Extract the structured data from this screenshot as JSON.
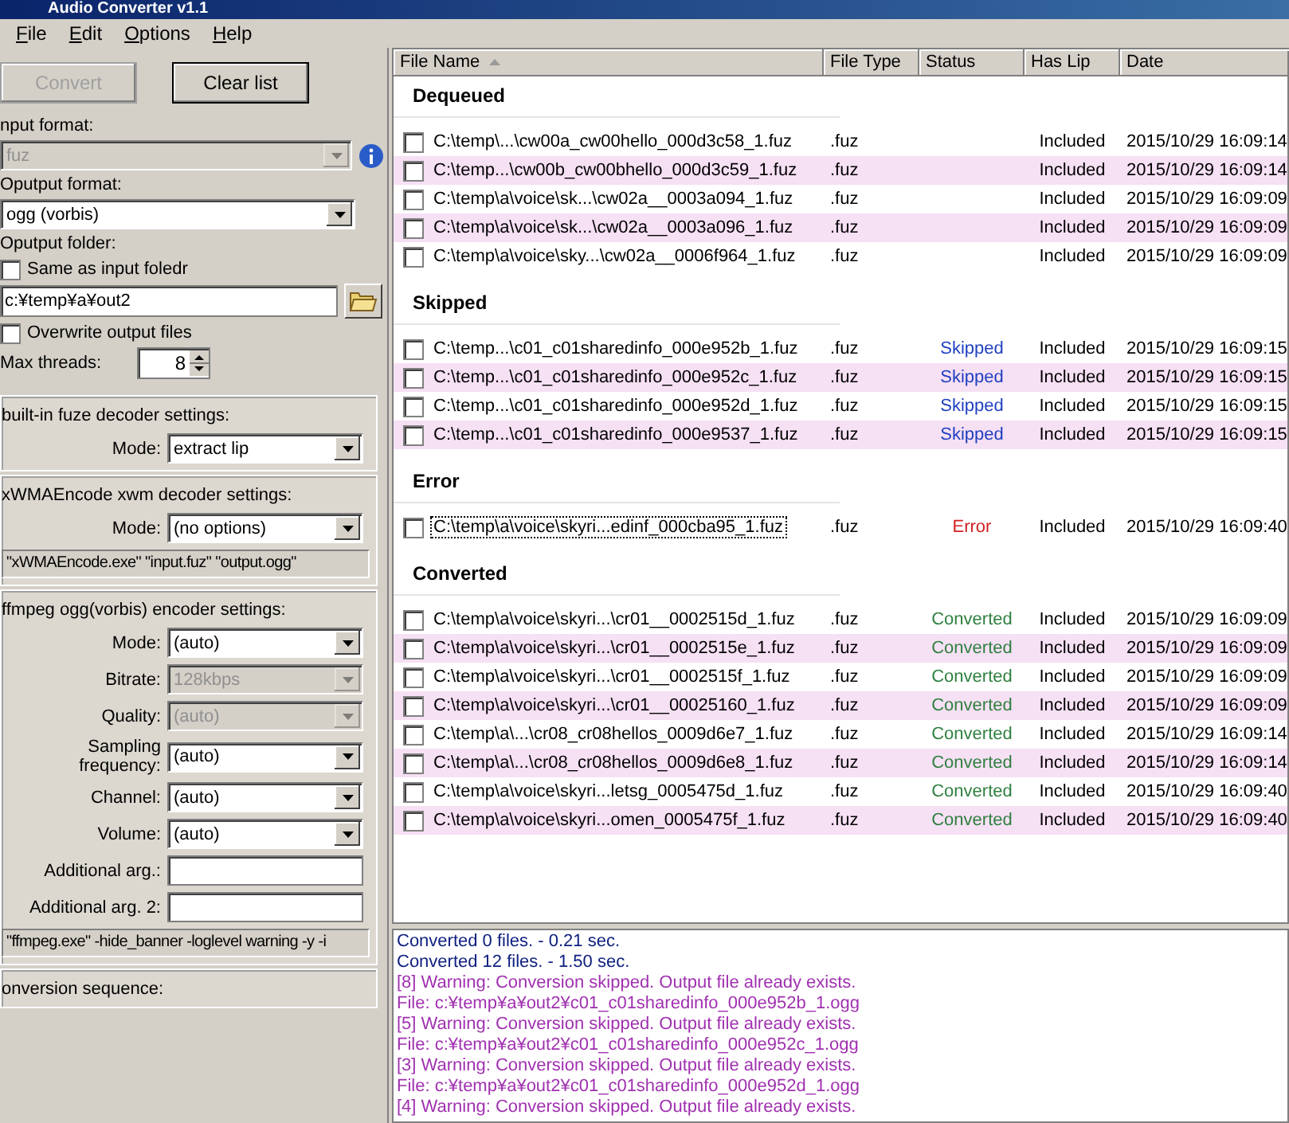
{
  "window": {
    "title": "Audio Converter v1.1"
  },
  "menu": [
    {
      "label": "File"
    },
    {
      "label": "Edit"
    },
    {
      "label": "Options"
    },
    {
      "label": "Help"
    }
  ],
  "buttons": [
    {
      "label": "Convert",
      "disabled": true
    },
    {
      "label": "Clear list",
      "disabled": false
    }
  ],
  "input_format": {
    "label": "nput format:",
    "value": "fuz",
    "disabled": true
  },
  "output_format": {
    "label": "Oputput format:",
    "value": "ogg (vorbis)",
    "disabled": false
  },
  "output_folder": {
    "label": "Oputput folder:",
    "same_as_input": {
      "label": "Same as input foledr",
      "checked": false
    },
    "path": "c:¥temp¥a¥out2"
  },
  "overwrite": {
    "label": "Overwrite output files",
    "checked": false
  },
  "max_threads": {
    "label": "Max threads:",
    "value": "8"
  },
  "groups": [
    {
      "title": "built-in fuze decoder settings:",
      "fields": [
        {
          "kind": "select",
          "label": "Mode:",
          "value": "extract lip",
          "disabled": false
        }
      ]
    },
    {
      "title": "xWMAEncode xwm decoder settings:",
      "fields": [
        {
          "kind": "select",
          "label": "Mode:",
          "value": "(no options)",
          "disabled": false
        }
      ],
      "command": "\"xWMAEncode.exe\" \"input.fuz\" \"output.ogg\""
    },
    {
      "title": "ffmpeg ogg(vorbis) encoder settings:",
      "fields": [
        {
          "kind": "select",
          "label": "Mode:",
          "value": "(auto)",
          "disabled": false
        },
        {
          "kind": "select",
          "label": "Bitrate:",
          "value": "128kbps",
          "disabled": true
        },
        {
          "kind": "select",
          "label": "Quality:",
          "value": "(auto)",
          "disabled": true
        },
        {
          "kind": "select",
          "label": "Sampling frequency:",
          "value": "(auto)",
          "disabled": false
        },
        {
          "kind": "select",
          "label": "Channel:",
          "value": "(auto)",
          "disabled": false
        },
        {
          "kind": "select",
          "label": "Volume:",
          "value": "(auto)",
          "disabled": false
        },
        {
          "kind": "text",
          "label": "Additional arg.:"
        },
        {
          "kind": "text",
          "label": "Additional arg. 2:"
        }
      ],
      "command": "\"ffmpeg.exe\" -hide_banner -loglevel warning -y -i"
    },
    {
      "title": "onversion sequence:"
    }
  ],
  "table": {
    "columns": [
      {
        "label": "File Name",
        "sorted": true
      },
      {
        "label": "File Type",
        "sorted": false
      },
      {
        "label": "Status",
        "sorted": false
      },
      {
        "label": "Has Lip",
        "sorted": false
      },
      {
        "label": "Date",
        "sorted": false
      }
    ],
    "groups": [
      {
        "title": "Dequeued",
        "rows": [
          {
            "name": "C:\\temp\\...\\cw00a_cw00hello_000d3c58_1.fuz",
            "type": ".fuz",
            "lip": "Included",
            "date": "2015/10/29 16:09:14",
            "checked": false,
            "focused": false
          },
          {
            "name": "C:\\temp...\\cw00b_cw00bhello_000d3c59_1.fuz",
            "type": ".fuz",
            "lip": "Included",
            "date": "2015/10/29 16:09:14",
            "checked": false,
            "focused": false
          },
          {
            "name": "C:\\temp\\a\\voice\\sk...\\cw02a__0003a094_1.fuz",
            "type": ".fuz",
            "lip": "Included",
            "date": "2015/10/29 16:09:09",
            "checked": false,
            "focused": false
          },
          {
            "name": "C:\\temp\\a\\voice\\sk...\\cw02a__0003a096_1.fuz",
            "type": ".fuz",
            "lip": "Included",
            "date": "2015/10/29 16:09:09",
            "checked": false,
            "focused": false
          },
          {
            "name": "C:\\temp\\a\\voice\\sky...\\cw02a__0006f964_1.fuz",
            "type": ".fuz",
            "lip": "Included",
            "date": "2015/10/29 16:09:09",
            "checked": false,
            "focused": false
          }
        ]
      },
      {
        "title": "Skipped",
        "rows": [
          {
            "name": "C:\\temp...\\c01_c01sharedinfo_000e952b_1.fuz",
            "type": ".fuz",
            "status": "Skipped",
            "color": "#2040c0",
            "lip": "Included",
            "date": "2015/10/29 16:09:15",
            "checked": false,
            "focused": false
          },
          {
            "name": "C:\\temp...\\c01_c01sharedinfo_000e952c_1.fuz",
            "type": ".fuz",
            "status": "Skipped",
            "color": "#2040c0",
            "lip": "Included",
            "date": "2015/10/29 16:09:15",
            "checked": false,
            "focused": false
          },
          {
            "name": "C:\\temp...\\c01_c01sharedinfo_000e952d_1.fuz",
            "type": ".fuz",
            "status": "Skipped",
            "color": "#2040c0",
            "lip": "Included",
            "date": "2015/10/29 16:09:15",
            "checked": false,
            "focused": false
          },
          {
            "name": "C:\\temp...\\c01_c01sharedinfo_000e9537_1.fuz",
            "type": ".fuz",
            "status": "Skipped",
            "color": "#2040c0",
            "lip": "Included",
            "date": "2015/10/29 16:09:15",
            "checked": false,
            "focused": false
          }
        ]
      },
      {
        "title": "Error",
        "rows": [
          {
            "name": "C:\\temp\\a\\voice\\skyri...edinf_000cba95_1.fuz",
            "type": ".fuz",
            "status": "Error",
            "color": "#d02020",
            "lip": "Included",
            "date": "2015/10/29 16:09:40",
            "checked": false,
            "focused": true
          }
        ]
      },
      {
        "title": "Converted",
        "rows": [
          {
            "name": "C:\\temp\\a\\voice\\skyri...\\cr01__0002515d_1.fuz",
            "type": ".fuz",
            "status": "Converted",
            "color": "#308040",
            "lip": "Included",
            "date": "2015/10/29 16:09:09",
            "checked": false,
            "focused": false
          },
          {
            "name": "C:\\temp\\a\\voice\\skyri...\\cr01__0002515e_1.fuz",
            "type": ".fuz",
            "status": "Converted",
            "color": "#308040",
            "lip": "Included",
            "date": "2015/10/29 16:09:09",
            "checked": false,
            "focused": false
          },
          {
            "name": "C:\\temp\\a\\voice\\skyri...\\cr01__0002515f_1.fuz",
            "type": ".fuz",
            "status": "Converted",
            "color": "#308040",
            "lip": "Included",
            "date": "2015/10/29 16:09:09",
            "checked": false,
            "focused": false
          },
          {
            "name": "C:\\temp\\a\\voice\\skyri...\\cr01__00025160_1.fuz",
            "type": ".fuz",
            "status": "Converted",
            "color": "#308040",
            "lip": "Included",
            "date": "2015/10/29 16:09:09",
            "checked": false,
            "focused": false
          },
          {
            "name": "C:\\temp\\a\\...\\cr08_cr08hellos_0009d6e7_1.fuz",
            "type": ".fuz",
            "status": "Converted",
            "color": "#308040",
            "lip": "Included",
            "date": "2015/10/29 16:09:14",
            "checked": false,
            "focused": false
          },
          {
            "name": "C:\\temp\\a\\...\\cr08_cr08hellos_0009d6e8_1.fuz",
            "type": ".fuz",
            "status": "Converted",
            "color": "#308040",
            "lip": "Included",
            "date": "2015/10/29 16:09:14",
            "checked": false,
            "focused": false
          },
          {
            "name": "C:\\temp\\a\\voice\\skyri...letsg_0005475d_1.fuz",
            "type": ".fuz",
            "status": "Converted",
            "color": "#308040",
            "lip": "Included",
            "date": "2015/10/29 16:09:40",
            "checked": false,
            "focused": false
          },
          {
            "name": "C:\\temp\\a\\voice\\skyri...omen_0005475f_1.fuz",
            "type": ".fuz",
            "status": "Converted",
            "color": "#308040",
            "lip": "Included",
            "date": "2015/10/29 16:09:40",
            "checked": false,
            "focused": false
          }
        ]
      }
    ]
  },
  "log": [
    {
      "kind": "info",
      "text": "Converted 0 files. - 0.21 sec."
    },
    {
      "kind": "info",
      "text": "Converted 12 files. - 1.50 sec."
    },
    {
      "kind": "warning",
      "text": "[8] Warning: Conversion skipped. Output file already exists."
    },
    {
      "kind": "warning",
      "text": "File: c:¥temp¥a¥out2¥c01_c01sharedinfo_000e952b_1.ogg"
    },
    {
      "kind": "warning",
      "text": "[5] Warning: Conversion skipped. Output file already exists."
    },
    {
      "kind": "warning",
      "text": "File: c:¥temp¥a¥out2¥c01_c01sharedinfo_000e952c_1.ogg"
    },
    {
      "kind": "warning",
      "text": "[3] Warning: Conversion skipped. Output file already exists."
    },
    {
      "kind": "warning",
      "text": "File: c:¥temp¥a¥out2¥c01_c01sharedinfo_000e952d_1.ogg"
    },
    {
      "kind": "warning",
      "text": "[4] Warning: Conversion skipped. Output file already exists."
    }
  ]
}
